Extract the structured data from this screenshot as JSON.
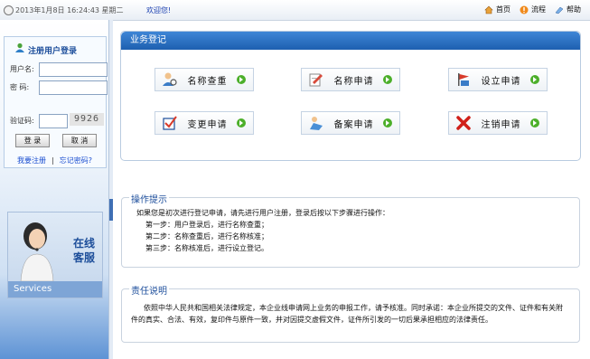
{
  "topbar": {
    "datetime": "2013年1月8日 16:24:43 星期二",
    "welcome": "欢迎您!",
    "links": [
      {
        "label": "首页",
        "icon": "home-icon"
      },
      {
        "label": "流程",
        "icon": "flow-icon"
      },
      {
        "label": "帮助",
        "icon": "help-icon"
      }
    ]
  },
  "login": {
    "title": "注册用户登录",
    "username_label": "用户名:",
    "password_label": "密 码:",
    "captcha_label": "验证码:",
    "captcha_text": "9926",
    "login_button": "登 录",
    "cancel_button": "取 消",
    "register_link": "我要注册",
    "forgot_link": "忘记密码?"
  },
  "service": {
    "line1": "在线",
    "line2": "客服",
    "footer": "Services"
  },
  "business": {
    "title": "业务登记",
    "buttons": [
      {
        "label": "名称查重",
        "icon": "user-search-icon"
      },
      {
        "label": "名称申请",
        "icon": "document-pen-icon"
      },
      {
        "label": "设立申请",
        "icon": "flag-icon"
      },
      {
        "label": "变更申请",
        "icon": "checkbox-icon"
      },
      {
        "label": "备案申请",
        "icon": "filing-icon"
      },
      {
        "label": "注销申请",
        "icon": "cancel-x-icon"
      }
    ]
  },
  "tips": {
    "title": "操作提示",
    "lines": [
      "如果您是初次进行登记申请，请先进行用户注册，登录后按以下步骤进行操作：",
      "第一步：用户登录后，进行名称查重；",
      "第二步：名称查重后，进行名称核准；",
      "第三步：名称核准后，进行设立登记。"
    ]
  },
  "liability": {
    "title": "责任说明",
    "text1": "依照中华人民共和国相关法律规定，本企业线申请网上业务的申报工作，请予核准。同时承诺：本企业所提交的文件、证件和有关附",
    "text2": "件的真实、合法、有效，复印件与原件一致，并对因提交虚假文件，证件所引发的一切后果承担相应的法律责任。"
  },
  "colors": {
    "header_blue": "#1d5fb0",
    "link_blue": "#1a4ed0",
    "go_green": "#4caf2a"
  }
}
